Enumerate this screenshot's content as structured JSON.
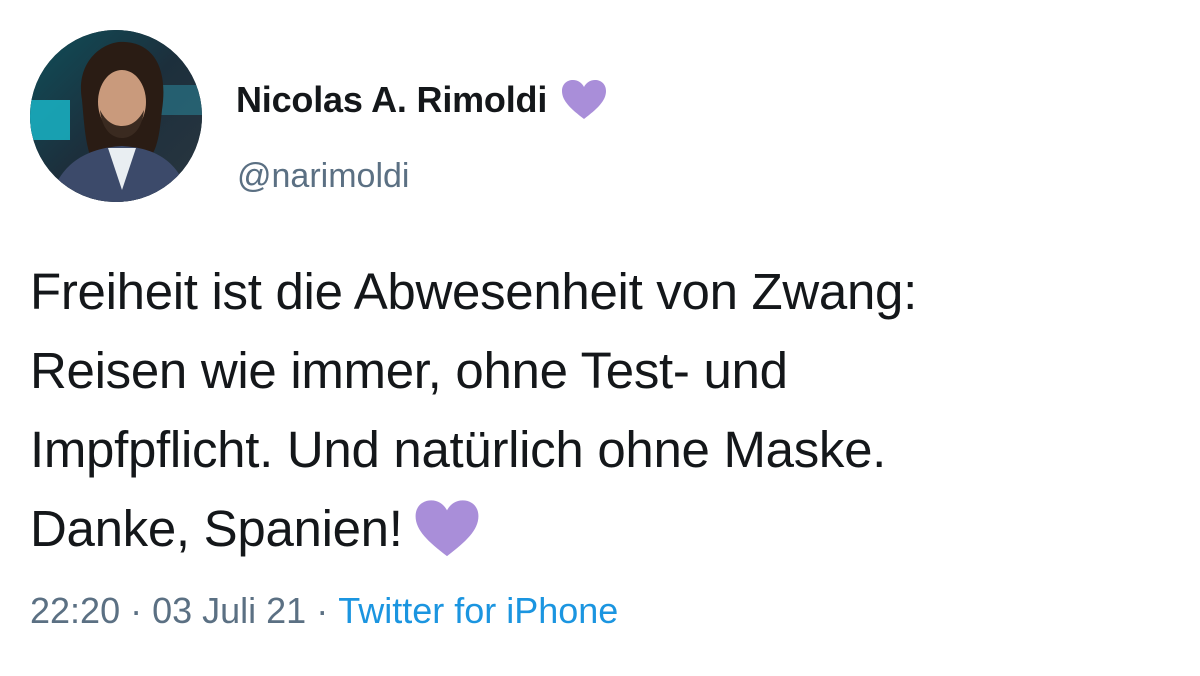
{
  "tweet": {
    "author": {
      "display_name": "Nicolas A. Rimoldi",
      "handle": "@narimoldi",
      "name_emoji": "purple-heart-icon"
    },
    "text_lines": [
      "Freiheit ist die Abwesenheit von Zwang:",
      "Reisen wie immer, ohne Test- und",
      "Impfpflicht. Und natürlich ohne Maske.",
      "Danke, Spanien!"
    ],
    "text_trailing_emoji": "purple-heart-icon",
    "time": "22:20",
    "separator": "·",
    "date": "03 Juli 21",
    "source": "Twitter for iPhone"
  },
  "colors": {
    "text": "#14171a",
    "secondary": "#5b7083",
    "link": "#1b95e0",
    "heart": "#a98ed9"
  }
}
